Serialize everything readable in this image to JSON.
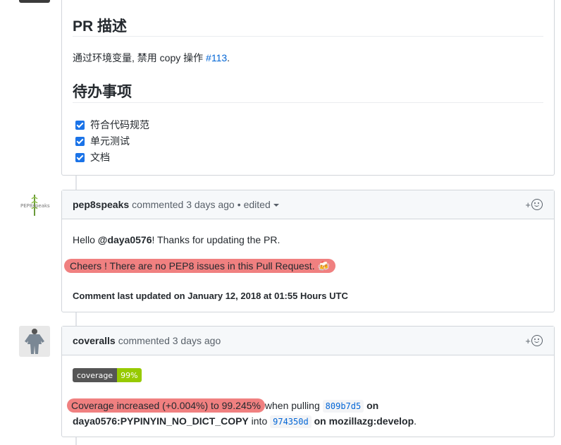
{
  "pr_body": {
    "heading_description": "PR 描述",
    "description_text": "通过环境变量, 禁用 copy 操作 ",
    "description_link": "#113",
    "description_tail": ".",
    "heading_todo": "待办事项",
    "tasks": [
      {
        "label": "符合代码规范",
        "checked": true
      },
      {
        "label": "单元测试",
        "checked": true
      },
      {
        "label": "文档",
        "checked": true
      }
    ]
  },
  "comments": [
    {
      "avatar_text": "PEP8speaks",
      "author": "pep8speaks",
      "action": "commented 3 days ago",
      "separator": "•",
      "edited": "edited",
      "greeting_prefix": "Hello ",
      "greeting_mention": "@daya0576",
      "greeting_suffix": "! Thanks for updating the PR.",
      "cheers": "Cheers ! There are no PEP8 issues in this Pull Request. ",
      "cheers_emoji": "🍻",
      "footer": "Comment last updated on January 12, 2018 at 01:55 Hours UTC"
    },
    {
      "author": "coveralls",
      "action": "commented 3 days ago",
      "badge_label": "coverage",
      "badge_value": "99%",
      "coverage_text": "Coverage increased (+0.004%) to 99.245%",
      "when_pulling": "when pulling ",
      "commit_from": "809b7d5",
      "on1": " on",
      "branch_from": "daya0576:PYPINYIN_NO_DICT_COPY",
      "into": " into ",
      "commit_to": "974350d",
      "on2": " on mozillazg:develop",
      "period": "."
    }
  ],
  "reaction_plus": "+",
  "colors": {
    "highlight": "#f08080",
    "link": "#0366d6",
    "checkbox": "#1a73e8",
    "badge_green": "#97ca00"
  }
}
